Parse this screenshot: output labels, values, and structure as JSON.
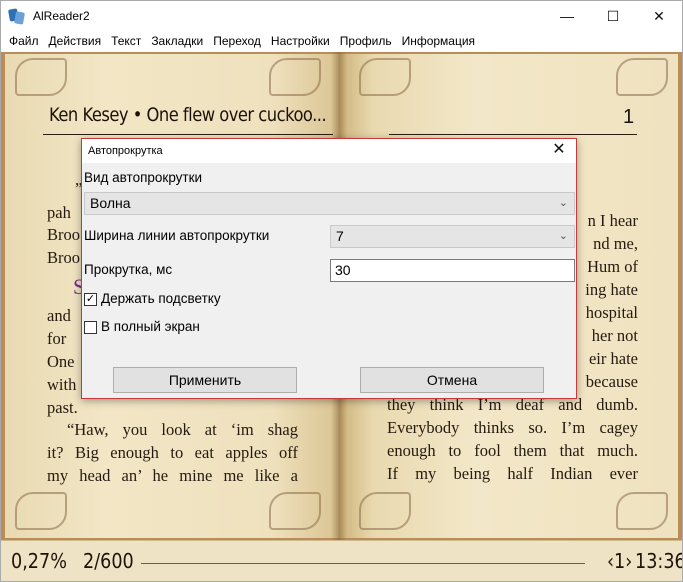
{
  "window": {
    "title": "AlReader2",
    "controls": {
      "minimize": "—",
      "maximize": "☐",
      "close": "✕"
    }
  },
  "menu": [
    "Файл",
    "Действия",
    "Текст",
    "Закладки",
    "Переход",
    "Настройки",
    "Профиль",
    "Информация"
  ],
  "book": {
    "header_title": "Ken Kesey • One flew over cuckoo...",
    "page_number": "1",
    "left_lines": [
      "„",
      "pah",
      "Broo",
      "Broo",
      "and",
      "for",
      "One",
      "with",
      "past.",
      "“Haw, you look at ‘im shag",
      "it? Big enough to eat apples off",
      "my head an’ he mine me like a"
    ],
    "left_drop_cap": "S",
    "right_lines": [
      "n I hear",
      "nd  me,",
      "Hum  of",
      "ing  hate",
      "hospital",
      "her  not",
      "eir  hate",
      "because",
      "they think I’m deaf and dumb.",
      "Everybody thinks so. I’m cagey",
      "enough to fool them that much.",
      "If  my  being  half  Indian  ever"
    ]
  },
  "status": {
    "percent": "0,27%",
    "pages": "2/600",
    "nav": "‹1›",
    "clock": "13:36",
    "progress_fraction": 0.0027
  },
  "dialog": {
    "title": "Автопрокрутка",
    "close": "✕",
    "scroll_type_label": "Вид автопрокрутки",
    "scroll_type_value": "Волна",
    "line_width_label": "Ширина линии автопрокрутки",
    "line_width_value": "7",
    "scroll_ms_label": "Прокрутка, мс",
    "scroll_ms_value": "30",
    "keep_highlight_label": "Держать подсветку",
    "keep_highlight_checked": true,
    "fullscreen_label": "В полный экран",
    "fullscreen_checked": false,
    "apply_label": "Применить",
    "cancel_label": "Отмена",
    "chevron": "⌄",
    "check_mark": "✓"
  }
}
